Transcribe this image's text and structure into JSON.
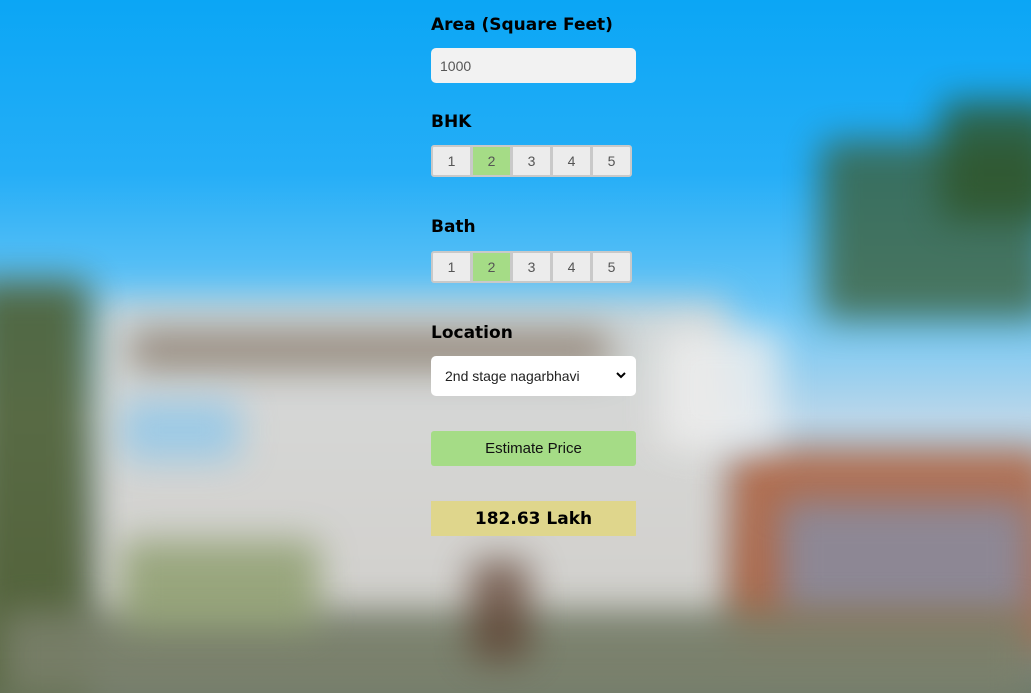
{
  "area": {
    "label": "Area (Square Feet)",
    "value": "1000"
  },
  "bhk": {
    "label": "BHK",
    "options": [
      "1",
      "2",
      "3",
      "4",
      "5"
    ],
    "selected": "2"
  },
  "bath": {
    "label": "Bath",
    "options": [
      "1",
      "2",
      "3",
      "4",
      "5"
    ],
    "selected": "2"
  },
  "location": {
    "label": "Location",
    "selected": "2nd stage nagarbhavi"
  },
  "estimate_button": {
    "label": "Estimate Price"
  },
  "result": {
    "text": "182.63 Lakh"
  },
  "colors": {
    "selected_option": "#a5dc86",
    "button": "#a5dc86",
    "result_bg": "#dfd68c"
  },
  "icons": {
    "select_arrow": "chevron-down-icon"
  }
}
